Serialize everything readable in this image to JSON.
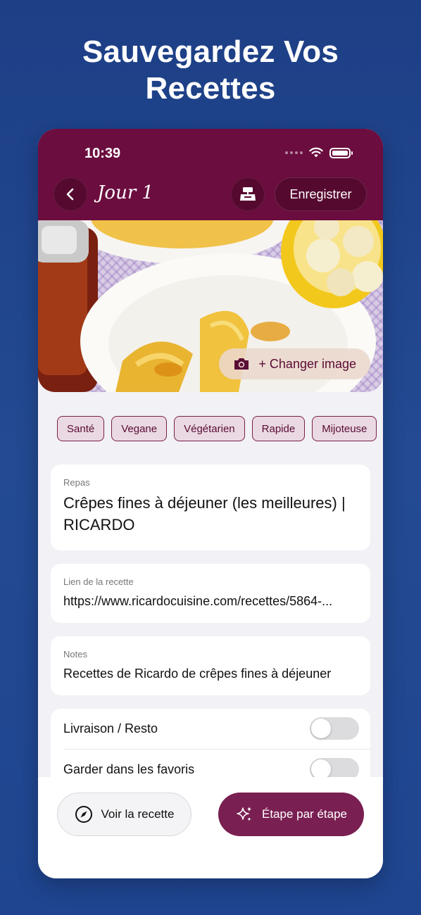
{
  "headline": {
    "line1": "Sauvegardez Vos",
    "line2": "Recettes"
  },
  "status_bar": {
    "time": "10:39"
  },
  "toolbar": {
    "title": "Jour 1",
    "save_label": "Enregistrer"
  },
  "hero": {
    "change_image_label": "+ Changer image"
  },
  "tags": [
    "Santé",
    "Vegane",
    "Végétarien",
    "Rapide",
    "Mijoteuse"
  ],
  "meal": {
    "label": "Repas",
    "value": "Crêpes fines à déjeuner (les meilleures) | RICARDO"
  },
  "link": {
    "label": "Lien de la recette",
    "value": "https://www.ricardocuisine.com/recettes/5864-..."
  },
  "notes": {
    "label": "Notes",
    "value": "Recettes de Ricardo de crêpes fines à déjeuner"
  },
  "settings": {
    "delivery_label": "Livraison / Resto",
    "delivery_on": false,
    "favorites_label": "Garder dans les favoris",
    "favorites_on": false
  },
  "actions": {
    "view_recipe": "Voir la recette",
    "step_by_step": "Étape par étape"
  },
  "colors": {
    "brand": "#6b0d3f",
    "accent_button": "#7a1f52",
    "background": "#1f4590"
  }
}
